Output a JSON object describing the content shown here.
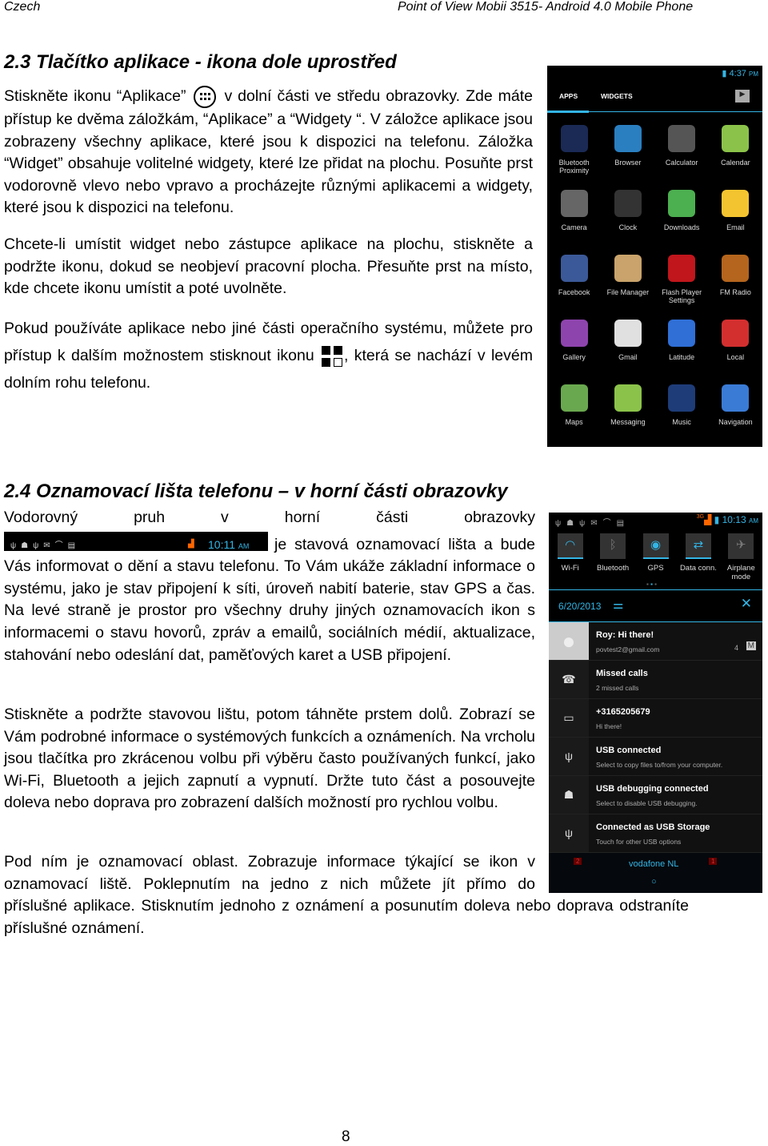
{
  "header": {
    "left": "Czech",
    "right": "Point of View Mobii 3515- Android 4.0 Mobile Phone"
  },
  "s23": {
    "title": "2.3 Tlačítko aplikace - ikona dole uprostřed",
    "p1a": "Stiskněte ikonu “Aplikace”",
    "p1b": "v dolní části ve středu obrazovky. Zde máte přístup ke dvěma záložkám, “Aplikace” a “Widgety “. V záložce aplikace jsou zobrazeny všechny aplikace, které jsou k dispozici na telefonu. Záložka “Widget” obsahuje volitelné widgety, které lze přidat na plochu. Posuňte prst vodorovně vlevo nebo vpravo a procházejte různými aplikacemi a widgety, které jsou k dispozici na telefonu.",
    "p2": "Chcete-li umístit widget nebo zástupce aplikace na plochu, stiskněte a podržte ikonu, dokud se neobjeví pracovní plocha. Přesuňte prst na místo, kde chcete ikonu umístit a poté uvolněte.",
    "p3a": "Pokud používáte aplikace nebo jiné části operačního systému, můžete pro přístup k dalším možnostem stisknout ikonu",
    "p3b": ", která se nachází v levém dolním rohu telefonu."
  },
  "phone1": {
    "time": "4:37",
    "ampm": "PM",
    "tabs": [
      "APPS",
      "WIDGETS"
    ],
    "apps": [
      {
        "label": "Bluetooth Proximity",
        "color": "#1a2a55"
      },
      {
        "label": "Browser",
        "color": "#2a7fc0"
      },
      {
        "label": "Calculator",
        "color": "#555"
      },
      {
        "label": "Calendar",
        "color": "#8bc34a"
      },
      {
        "label": "Camera",
        "color": "#666"
      },
      {
        "label": "Clock",
        "color": "#333"
      },
      {
        "label": "Downloads",
        "color": "#4caf50"
      },
      {
        "label": "Email",
        "color": "#f4c430"
      },
      {
        "label": "Facebook",
        "color": "#3b5998"
      },
      {
        "label": "File Manager",
        "color": "#c9a36b"
      },
      {
        "label": "Flash Player Settings",
        "color": "#c0161c"
      },
      {
        "label": "FM Radio",
        "color": "#b5651d"
      },
      {
        "label": "Gallery",
        "color": "#8e44ad"
      },
      {
        "label": "Gmail",
        "color": "#e0e0e0"
      },
      {
        "label": "Latitude",
        "color": "#2f6fd6"
      },
      {
        "label": "Local",
        "color": "#d32f2f"
      },
      {
        "label": "Maps",
        "color": "#6aa84f"
      },
      {
        "label": "Messaging",
        "color": "#8bc34a"
      },
      {
        "label": "Music",
        "color": "#1e3c78"
      },
      {
        "label": "Navigation",
        "color": "#3a7bd5"
      }
    ]
  },
  "s24": {
    "title": "2.4 Oznamovací lišta telefonu – v horní části obrazovky",
    "p1a": "Vodorovný pruh v horní části obrazovky",
    "statusbar_time": "10:11",
    "statusbar_ampm": "AM",
    "p1b": "je stavová oznamovací lišta a bude Vás informovat o dění a stavu telefonu. To Vám ukáže základní informace o systému, jako je stav připojení k síti, úroveň nabití baterie, stav GPS a čas. Na levé straně je prostor pro všechny druhy jiných oznamovacích ikon s informacemi o stavu hovorů, zpráv a emailů, sociálních médií, aktualizace, stahování nebo odeslání dat, paměťových karet a USB připojení.",
    "p2": "Stiskněte a podržte stavovou lištu, potom táhněte prstem dolů. Zobrazí se Vám podrobné informace o systémových funkcích a oznámeních. Na vrcholu jsou tlačítka pro zkrácenou volbu při výběru často používaných funkcí, jako Wi-Fi, Bluetooth a jejich zapnutí a vypnutí. Držte tuto část a posouvejte doleva nebo doprava pro zobrazení dalších možností pro rychlou volbu.",
    "p3a": "Pod ním je oznamovací oblast. Zobrazuje informace týkající se ikon v oznamovací liště. Poklepnutím na jedno z nich můžete jít přímo do",
    "p3b": "příslušné aplikace. Stisknutím jednoho z oznámení a posunutím doleva nebo doprava odstraníte příslušné oznámení."
  },
  "phone2": {
    "time": "10:13",
    "ampm": "AM",
    "network": "3G",
    "date": "6/20/2013",
    "toggles": [
      {
        "label": "Wi-Fi",
        "on": true,
        "glyph": "◠"
      },
      {
        "label": "Bluetooth",
        "on": false,
        "glyph": "ᛒ"
      },
      {
        "label": "GPS",
        "on": true,
        "glyph": "◉"
      },
      {
        "label": "Data conn.",
        "on": true,
        "glyph": "⇄"
      },
      {
        "label": "Airplane mode",
        "on": false,
        "glyph": "✈"
      }
    ],
    "notifications": [
      {
        "title": "Roy: Hi there!",
        "sub": "povtest2@gmail.com",
        "count": "4",
        "icon": "avatar"
      },
      {
        "title": "Missed calls",
        "sub": "2 missed calls",
        "icon": "missed-call"
      },
      {
        "title": "+3165205679",
        "sub": "Hi there!",
        "icon": "message"
      },
      {
        "title": "USB connected",
        "sub": "Select to copy files to/from your computer.",
        "icon": "usb"
      },
      {
        "title": "USB debugging connected",
        "sub": "Select to disable USB debugging.",
        "icon": "android"
      },
      {
        "title": "Connected as USB Storage",
        "sub": "Touch for other USB options",
        "icon": "usb"
      }
    ],
    "carrier": "vodafone NL",
    "dock_badges": [
      "2",
      "1"
    ]
  },
  "page_number": "8"
}
